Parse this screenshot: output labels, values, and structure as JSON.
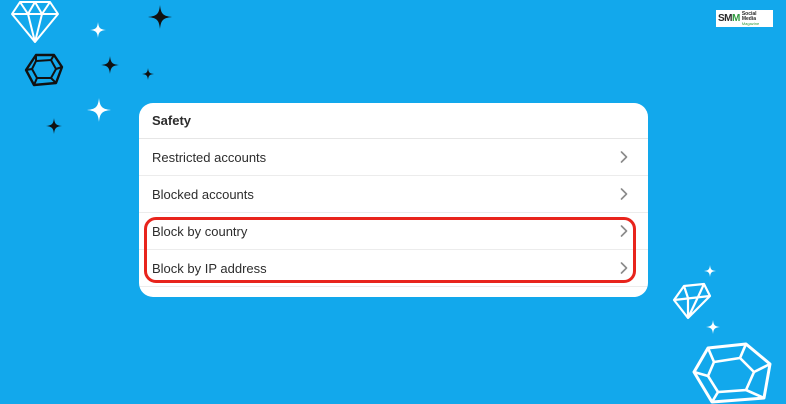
{
  "brand": {
    "logo_mark_s": "SM",
    "logo_mark_m": "M",
    "logo_line1": "Social Media",
    "logo_line2": "Magazine",
    "background_color": "#12a8ec",
    "highlight_color": "#e8241c"
  },
  "settings": {
    "section_title": "Safety",
    "items": [
      {
        "label": "Restricted accounts",
        "icon": "chevron-right-icon"
      },
      {
        "label": "Blocked accounts",
        "icon": "chevron-right-icon"
      },
      {
        "label": "Block by country",
        "icon": "chevron-right-icon"
      },
      {
        "label": "Block by IP address",
        "icon": "chevron-right-icon"
      }
    ]
  }
}
